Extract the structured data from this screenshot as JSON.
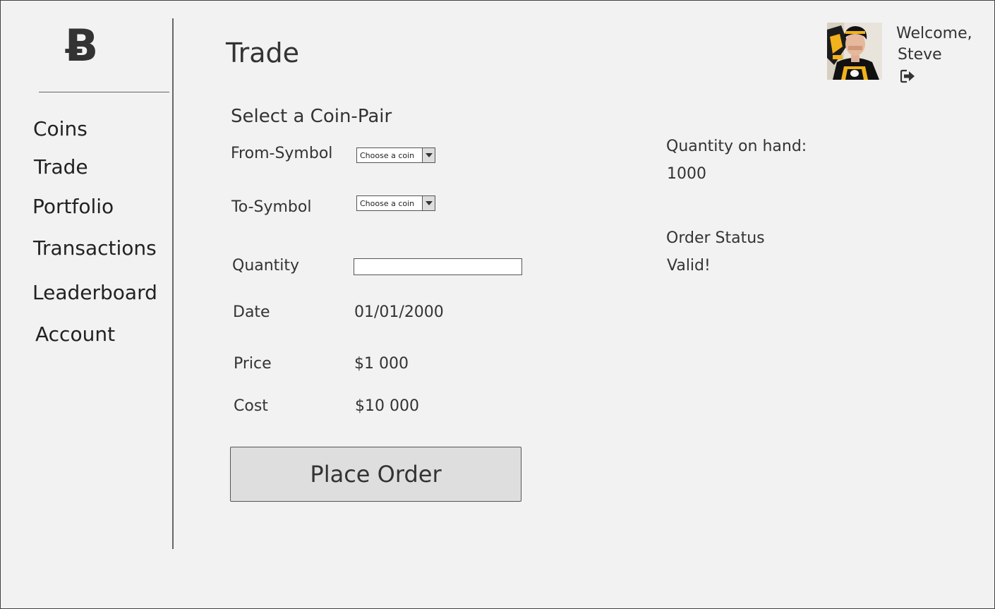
{
  "sidebar": {
    "logo_glyph": "Ƀ",
    "items": [
      {
        "label": "Coins"
      },
      {
        "label": "Trade"
      },
      {
        "label": "Portfolio"
      },
      {
        "label": "Transactions"
      },
      {
        "label": "Leaderboard"
      },
      {
        "label": "Account"
      }
    ]
  },
  "header": {
    "title": "Trade",
    "welcome_line1": "Welcome,",
    "welcome_line2": "Steve",
    "logout_icon": "sign-out-icon"
  },
  "form": {
    "section_title": "Select a Coin-Pair",
    "from_label": "From-Symbol",
    "from_value": "Choose a coin",
    "to_label": "To-Symbol",
    "to_value": "Choose a coin",
    "quantity_label": "Quantity",
    "quantity_value": "",
    "date_label": "Date",
    "date_value": "01/01/2000",
    "price_label": "Price",
    "price_value": "$1 000",
    "cost_label": "Cost",
    "cost_value": "$10 000",
    "submit_label": "Place Order"
  },
  "info": {
    "qoh_label": "Quantity on hand:",
    "qoh_value": "1000",
    "status_label": "Order Status",
    "status_value": "Valid!"
  }
}
